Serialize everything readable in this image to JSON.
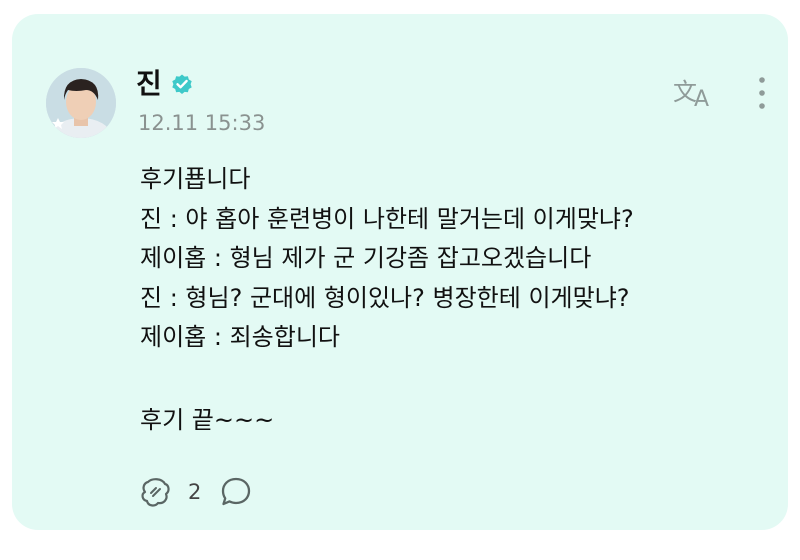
{
  "post": {
    "author": "진",
    "verified": true,
    "timestamp": "12.11 15:33",
    "lines": [
      "후기푭니다",
      "진 : 야 홉아 훈련병이 나한테 말거는데 이게맞냐?",
      "제이홉 : 형님 제가 군 기강좀 잡고오겠습니다",
      "진 : 형님? 군대에 형이있나? 병장한테 이게맞냐?",
      "제이홉 : 죄송합니다"
    ],
    "closing": "후기 끝~~~",
    "reaction_count": "2"
  },
  "icons": {
    "verified": "verified-badge-icon",
    "translate": "translate-icon",
    "more": "more-vertical-icon",
    "reaction": "reaction-icon",
    "comment": "comment-icon"
  },
  "colors": {
    "card_background": "#e3faf4",
    "verified_badge": "#3ec9c9",
    "muted_text": "#8a9290"
  }
}
